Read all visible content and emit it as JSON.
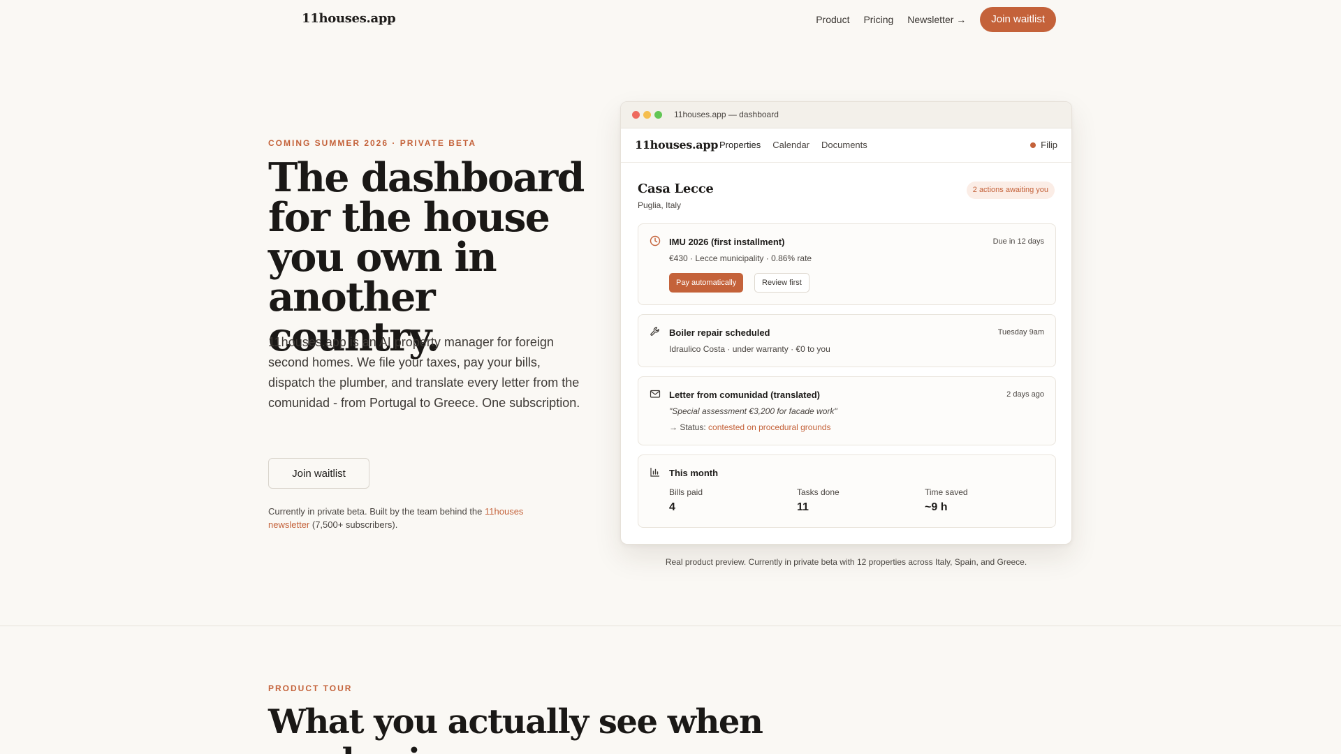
{
  "nav": {
    "logo": "11houses.app",
    "links": [
      "Product",
      "Pricing",
      "Newsletter →"
    ],
    "cta": "Join waitlist"
  },
  "hero": {
    "eyebrow": "COMING SUMMER 2026 · PRIVATE BETA",
    "title": "The dashboard for the house you own in another country.",
    "subtitle": "11houses.app is an AI property manager for foreign second homes. We file your taxes, pay your bills, dispatch the plumber, and translate every letter from the comunidad - from Portugal to Greece. One subscription.",
    "cta": "Join waitlist",
    "note_prefix": "Currently in private beta. Built by the team behind the ",
    "note_link": "11houses newsletter",
    "note_suffix": " (7,500+ subscribers)."
  },
  "dashboard": {
    "titlebar": "11houses.app — dashboard",
    "app_logo": "11houses.app",
    "tabs": [
      "Properties",
      "Calendar",
      "Documents"
    ],
    "user": "Filip",
    "property_name": "Casa Lecce",
    "property_location": "Puglia, Italy",
    "badge": "2 actions awaiting you",
    "cards": [
      {
        "icon": "clock-icon",
        "title": "IMU 2026 (first installment)",
        "meta": "Due in 12 days",
        "line1": "€430 · Lecce municipality · 0.86% rate",
        "primary": "Pay automatically",
        "secondary": "Review first"
      },
      {
        "icon": "wrench-icon",
        "title": "Boiler repair scheduled",
        "meta": "Tuesday 9am",
        "line1": "Idraulico Costa · under warranty · €0 to you"
      },
      {
        "icon": "mail-icon",
        "title": "Letter from comunidad (translated)",
        "meta": "2 days ago",
        "line1": "\"Special assessment €3,200 for facade work\"",
        "status_prefix": "→ Status: ",
        "status_value": "contested on procedural grounds"
      },
      {
        "icon": "bar-chart-icon",
        "title": "This month",
        "stats": [
          {
            "label": "Bills paid",
            "value": "4"
          },
          {
            "label": "Tasks done",
            "value": "11"
          },
          {
            "label": "Time saved",
            "value": "~9 h"
          }
        ]
      }
    ],
    "caption": "Real product preview. Currently in private beta with 12 properties across Italy, Spain, and Greece."
  },
  "tour": {
    "eyebrow": "PRODUCT TOUR",
    "title": "What you actually see when you log in."
  },
  "colors": {
    "accent": "#c4623a",
    "background": "#faf8f4",
    "text": "#1e1c1a"
  }
}
